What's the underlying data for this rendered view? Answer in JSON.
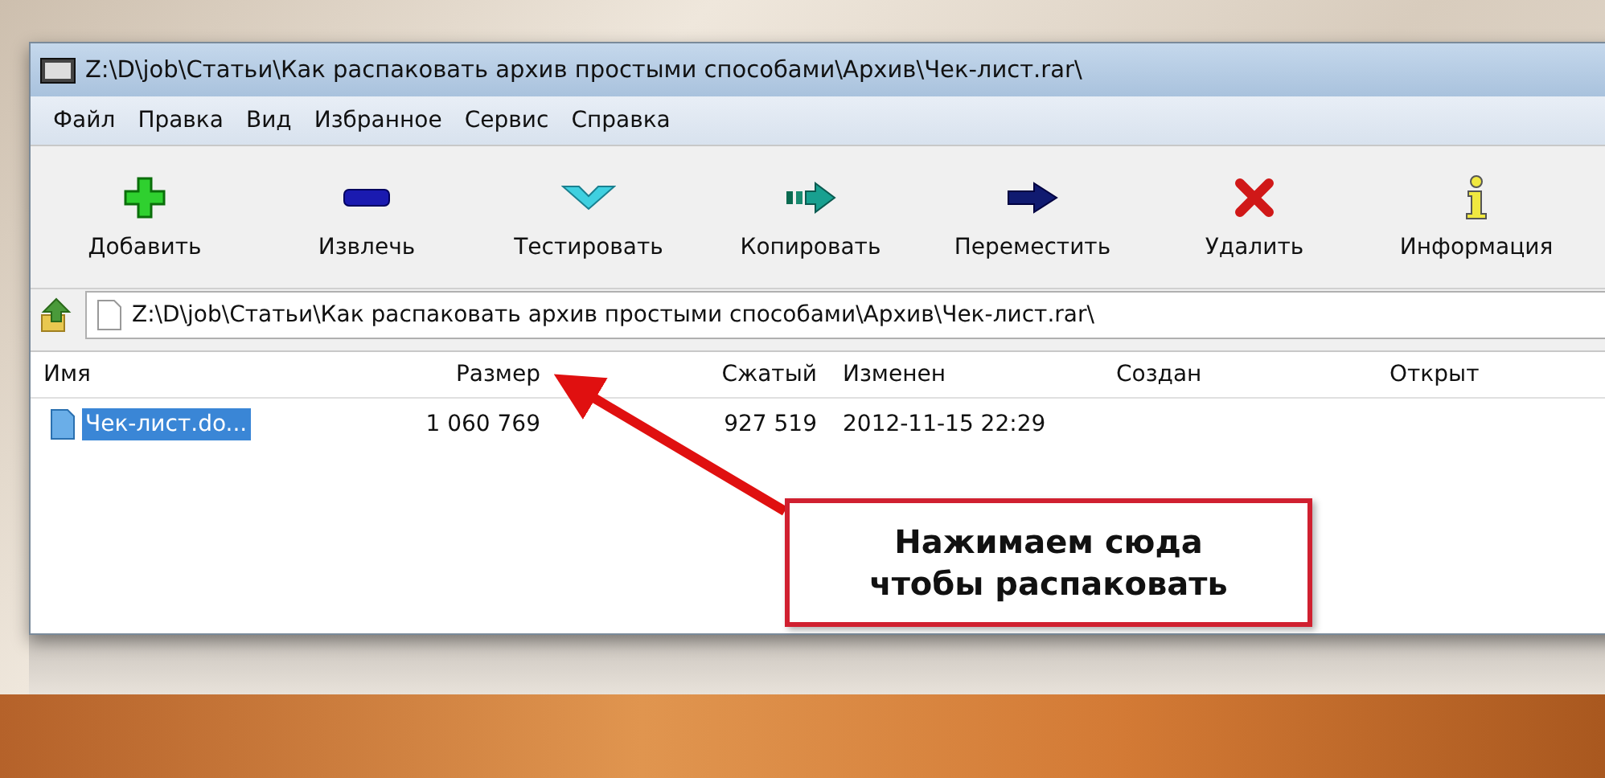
{
  "window": {
    "title": "Z:\\D\\job\\Статьи\\Как распаковать архив простыми способами\\Архив\\Чек-лист.rar\\"
  },
  "menu": [
    "Файл",
    "Правка",
    "Вид",
    "Избранное",
    "Сервис",
    "Справка"
  ],
  "toolbar": [
    {
      "label": "Добавить",
      "kind": "add"
    },
    {
      "label": "Извлечь",
      "kind": "extract"
    },
    {
      "label": "Тестировать",
      "kind": "test"
    },
    {
      "label": "Копировать",
      "kind": "copy"
    },
    {
      "label": "Переместить",
      "kind": "move"
    },
    {
      "label": "Удалить",
      "kind": "delete"
    },
    {
      "label": "Информация",
      "kind": "info"
    }
  ],
  "address": {
    "value": "Z:\\D\\job\\Статьи\\Как распаковать архив простыми способами\\Архив\\Чек-лист.rar\\"
  },
  "table": {
    "columns": [
      "Имя",
      "Размер",
      "Сжатый",
      "Изменен",
      "Создан",
      "Открыт"
    ],
    "rows": [
      {
        "cells": [
          "Чек-лист.do...",
          "1 060 769",
          "927 519",
          "2012-11-15 22:29"
        ],
        "selected": true
      }
    ]
  },
  "callout": {
    "lines": [
      "Нажимаем сюда",
      "чтобы распаковать"
    ]
  }
}
